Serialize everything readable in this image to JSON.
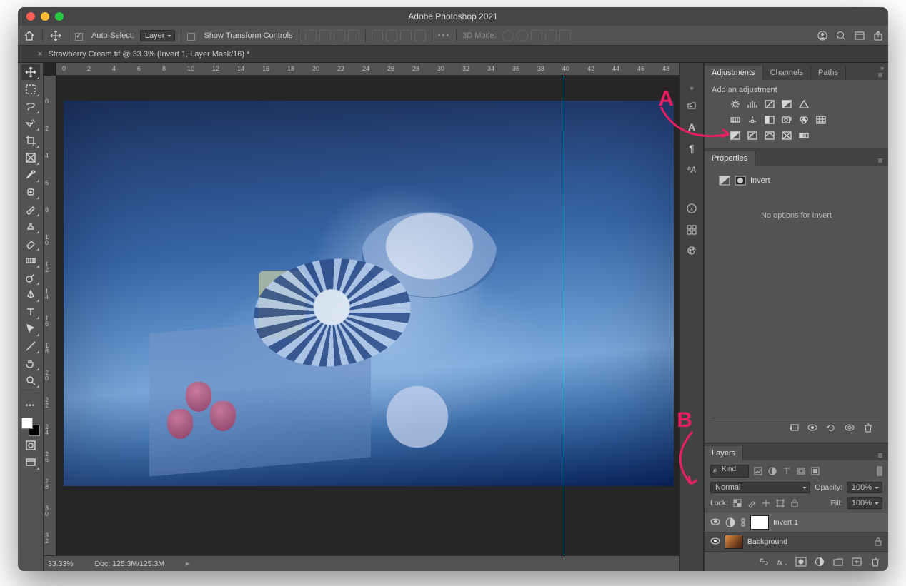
{
  "window": {
    "title": "Adobe Photoshop 2021"
  },
  "optionsbar": {
    "auto_select_label": "Auto-Select:",
    "auto_select_target": "Layer",
    "show_transform_label": "Show Transform Controls",
    "three_d_label": "3D Mode:"
  },
  "document": {
    "tab_title": "Strawberry Cream.tif @ 33.3% (Invert 1, Layer Mask/16) *",
    "zoom": "33.33%",
    "doc_info": "Doc: 125.3M/125.3M"
  },
  "ruler": {
    "top_ticks": [
      "0",
      "2",
      "4",
      "6",
      "8",
      "10",
      "12",
      "14",
      "16",
      "18",
      "20",
      "22",
      "24",
      "26",
      "28",
      "30",
      "32",
      "34",
      "36",
      "38",
      "40",
      "42",
      "44",
      "46",
      "48"
    ],
    "left_ticks": [
      "0",
      "2",
      "4",
      "6",
      "8",
      "1\n0",
      "1\n2",
      "1\n4",
      "1\n6",
      "1\n8",
      "2\n0",
      "2\n2",
      "2\n4",
      "2\n6",
      "2\n8",
      "3\n0",
      "3\n2"
    ]
  },
  "panels": {
    "adjustments_tabs": [
      "Adjustments",
      "Channels",
      "Paths"
    ],
    "add_adjustment_label": "Add an adjustment",
    "properties_tab": "Properties",
    "invert_label": "Invert",
    "no_options_text": "No options for Invert",
    "layers_tab": "Layers",
    "filter_label": "Kind",
    "blend_mode": "Normal",
    "opacity_label": "Opacity:",
    "opacity_value": "100%",
    "lock_label": "Lock:",
    "fill_label": "Fill:",
    "fill_value": "100%",
    "layers": [
      {
        "name": "Invert 1",
        "selected": true
      },
      {
        "name": "Background",
        "locked": true
      }
    ]
  },
  "annotations": {
    "A": "A",
    "B": "B"
  }
}
